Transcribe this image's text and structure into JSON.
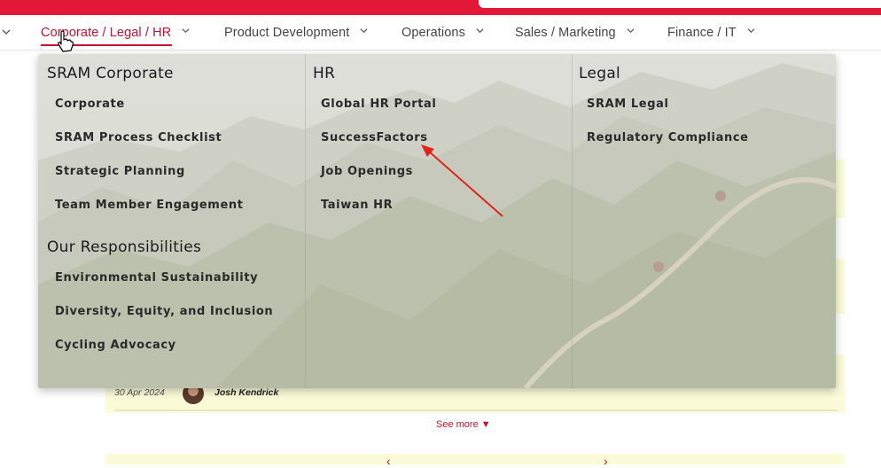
{
  "nav": {
    "items": [
      {
        "label": "Corporate / Legal / HR",
        "active": true
      },
      {
        "label": "Product Development"
      },
      {
        "label": "Operations"
      },
      {
        "label": "Sales / Marketing"
      },
      {
        "label": "Finance / IT"
      }
    ],
    "accent_color": "#c8102e"
  },
  "dropdown": {
    "columns": [
      {
        "sections": [
          {
            "heading": "SRAM Corporate",
            "links": [
              "Corporate",
              "SRAM Process Checklist",
              "Strategic Planning",
              "Team Member Engagement"
            ]
          },
          {
            "heading": "Our Responsibilities",
            "links": [
              "Environmental Sustainability",
              "Diversity, Equity, and Inclusion",
              "Cycling Advocacy"
            ]
          }
        ]
      },
      {
        "sections": [
          {
            "heading": "HR",
            "links": [
              "Global HR Portal",
              "SuccessFactors",
              "Job Openings",
              "Taiwan HR"
            ]
          }
        ]
      },
      {
        "sections": [
          {
            "heading": "Legal",
            "links": [
              "SRAM Legal",
              "Regulatory Compliance"
            ]
          }
        ]
      }
    ]
  },
  "background": {
    "post_date": "30 Apr 2024",
    "post_author": "Josh Kendrick",
    "see_more": "See more ▼"
  }
}
